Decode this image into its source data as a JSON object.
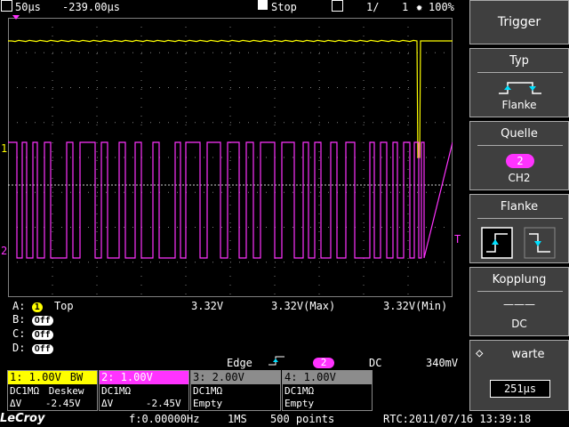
{
  "status": {
    "timebase": "50µs",
    "delay": "-239.00µs",
    "run_state": "Stop",
    "acq_count": "1/",
    "acq_total": "1",
    "zoom_level": "100%",
    "icons": [
      "save-icon",
      "stop-icon",
      "multiframe-icon",
      "zoom-icon"
    ]
  },
  "menu": {
    "title": "Trigger",
    "typ_label": "Typ",
    "typ_value": "Flanke",
    "quelle_label": "Quelle",
    "quelle_badge": "2",
    "quelle_value": "CH2",
    "flanke_label": "Flanke",
    "kopplung_label": "Kopplung",
    "kopplung_symbol": "———",
    "kopplung_value": "DC",
    "warte_label": "warte",
    "warte_value": "251µs"
  },
  "markers": {
    "ch1": "1",
    "ch2": "2",
    "trigger_level": "T"
  },
  "measurements": {
    "row_a_label": "A:",
    "row_a_badge": "1",
    "row_a_name": "Top",
    "row_a_v1": "3.32V",
    "row_a_v2": "3.32V(Max)",
    "row_a_v3": "3.32V(Min)",
    "row_b_label": "B:",
    "row_c_label": "C:",
    "row_d_label": "D:",
    "off_text": "Off"
  },
  "trigger_info": {
    "mode": "Edge",
    "source_badge": "2",
    "coupling": "DC",
    "level": "340mV"
  },
  "channels": [
    {
      "head": "1: 1.00V",
      "bw": "BW",
      "row1": "DC1MΩ",
      "row1b": "Deskew",
      "row2": "ΔV",
      "row2b": "-2.45V"
    },
    {
      "head": "2: 1.00V",
      "row1": "DC1MΩ",
      "row2": "ΔV",
      "row2b": "-2.45V"
    },
    {
      "head": "3: 2.00V",
      "row1": "DC1MΩ",
      "row2": "Empty"
    },
    {
      "head": "4: 1.00V",
      "row1": "DC1MΩ",
      "row2": "Empty"
    }
  ],
  "footer": {
    "brand": "LeCroy",
    "freq": "f:0.00000Hz",
    "rate": "1MS",
    "points": "500 points",
    "rtc": "RTC:2011/07/16 13:39:18"
  },
  "colors": {
    "ch1": "#ffff00",
    "ch2": "#ff33ff",
    "ch3": "#ffffff",
    "ch4": "#ffffff",
    "menu_bg": "#3f3f3f",
    "grid": "#808080"
  }
}
